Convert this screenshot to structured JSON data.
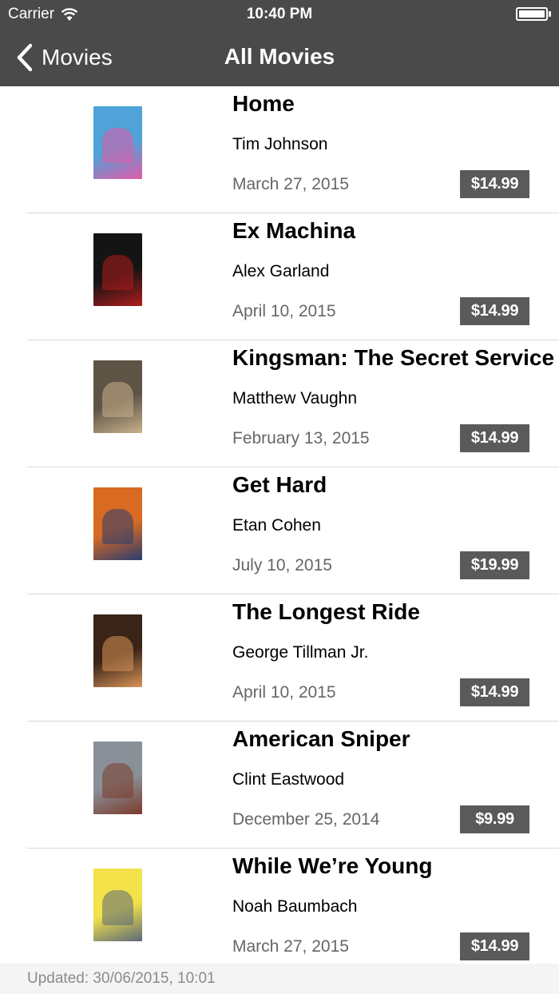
{
  "status_bar": {
    "carrier": "Carrier",
    "time": "10:40 PM"
  },
  "nav": {
    "back_label": "Movies",
    "title": "All Movies"
  },
  "movies": [
    {
      "title": "Home",
      "director": "Tim Johnson",
      "date": "March 27, 2015",
      "price": "$14.99",
      "poster_color": "#4fa3d8",
      "poster_accent": "#e35aa8"
    },
    {
      "title": "Ex Machina",
      "director": "Alex Garland",
      "date": "April 10, 2015",
      "price": "$14.99",
      "poster_color": "#141414",
      "poster_accent": "#b01c1c"
    },
    {
      "title": "Kingsman: The Secret Service",
      "director": "Matthew Vaughn",
      "date": "February 13, 2015",
      "price": "$14.99",
      "poster_color": "#5e5446",
      "poster_accent": "#c9b18a"
    },
    {
      "title": "Get Hard",
      "director": "Etan Cohen",
      "date": "July 10, 2015",
      "price": "$19.99",
      "poster_color": "#d86a22",
      "poster_accent": "#2a3c70"
    },
    {
      "title": "The Longest Ride",
      "director": "George Tillman Jr.",
      "date": "April 10, 2015",
      "price": "$14.99",
      "poster_color": "#3a2418",
      "poster_accent": "#d89458"
    },
    {
      "title": "American Sniper",
      "director": "Clint Eastwood",
      "date": "December 25, 2014",
      "price": "$9.99",
      "poster_color": "#8a9098",
      "poster_accent": "#7a3a2a"
    },
    {
      "title": "While We’re Young",
      "director": "Noah Baumbach",
      "date": "March 27, 2015",
      "price": "$14.99",
      "poster_color": "#f4e24a",
      "poster_accent": "#5a6878"
    }
  ],
  "footer": {
    "updated": "Updated: 30/06/2015, 10:01"
  },
  "colors": {
    "nav_background": "#4a4a4a",
    "price_background": "#5a5a5a",
    "footer_background": "#f4f4f4"
  }
}
